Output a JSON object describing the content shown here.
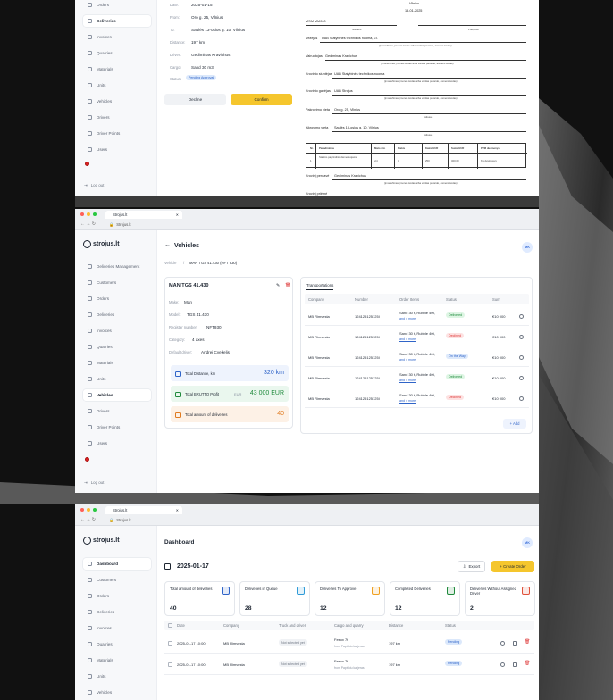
{
  "colors": {
    "accent": "#f5c62d",
    "primary": "#2f64c8",
    "success": "#1f8a3c",
    "danger": "#d33"
  },
  "w1": {
    "nav": [
      {
        "label": "Orders",
        "active": false
      },
      {
        "label": "Deliveries",
        "active": true
      },
      {
        "label": "Invoices",
        "active": false
      },
      {
        "label": "Quarries",
        "active": false
      },
      {
        "label": "Materials",
        "active": false
      },
      {
        "label": "Units",
        "active": false
      },
      {
        "label": "Vehicles",
        "active": false
      },
      {
        "label": "Drivers",
        "active": false
      },
      {
        "label": "Driver Points",
        "active": false
      },
      {
        "label": "Users",
        "active": false
      }
    ],
    "logout": "Log out",
    "details": {
      "date_label": "Date:",
      "date": "2025-01-15",
      "from_label": "From:",
      "from": "Oro g. 25, Vilnius",
      "to_label": "To:",
      "to": "Saulės 13-osios g. 10, Vilnius",
      "distance_label": "Distance:",
      "distance": "197 km",
      "driver_label": "Driver:",
      "driver": "Gediminas Kravichus",
      "cargo_label": "Cargo:",
      "cargo": "Sand 30 m3",
      "status_label": "Status:",
      "status": "Pending Approval"
    },
    "decline": "Decline",
    "confirm": "Confirm",
    "doc": {
      "city": "Vilnius",
      "date": "15-01-2025",
      "number": "MSM MM000",
      "sub1": "Numeris",
      "sub2": "Prekybos",
      "vezejas_label": "Vežėjas",
      "vezejas": "UAB Statybinės technikos nuoma, Lt.",
      "vezejas_sub": "(įmonė/limas, įmonės kodas arba vardas pavardė, asmens kodas)",
      "vezejas_sub2": "(įmonė/limas, įmonės kodas arba vardas pavardė, asmens kodas)",
      "vairuotojas_label": "Vairuotojas",
      "vairuotojas": "Gediminas Kravichus",
      "vairuotojas_sub": "(įmonė/limas, įmonės kodas arba vardas pavardė, asmens kodas)",
      "siuntejas_label": "Krovinio siuntėjas",
      "siuntejas": "UAB Statybinės technikos nuoma",
      "siuntejas_sub": "(įmonė/limas, įmonės kodas arba vardas pavardė, asmens kodas)",
      "gavejas_label": "Krovinio gavėjas",
      "gavejas": "UAB Strojus",
      "gavejas_sub": "(įmonė/limas, įmonės kodas arba vardas pavardė, asmens kodas)",
      "pakrovimo_label": "Pakrovimo vieta",
      "pakrovimo": "Oro g. 25, Vilnius",
      "pakrovimo_sub": "Adresas",
      "iskrovimo_label": "Iškrovimo vieta",
      "iskrovimo": "Saulės 13-osios g. 10, Vilnius",
      "iskrovimo_sub": "Adresas",
      "table_headers": [
        "Nr.",
        "Pavadinimas",
        "Mato vnt.",
        "Kiekis",
        "Kaina EUR",
        "Suma EUR",
        "PVM duomenys"
      ],
      "table_row": [
        "1",
        "Statinio pagrindinis dėmesiuojama",
        "vnt",
        "3",
        "250",
        "320.00",
        "KS devimosys"
      ],
      "priemes_label": "Krovinį perdavė",
      "priemes": "Gediminas Kravichus",
      "priemes_sub": "(įmonė/limas, įmonės kodas arba vardas pavardė, asmens kodas)",
      "footer_label": "Krovinį priėmė"
    }
  },
  "w2": {
    "tab_title": "Strojus.lt",
    "url": "Strojus.lt",
    "logo": "strojus.lt",
    "nav": [
      {
        "label": "Deliveries Management",
        "active": false
      },
      {
        "label": "Customers",
        "active": false
      },
      {
        "label": "Orders",
        "active": false
      },
      {
        "label": "Deliveries",
        "active": false
      },
      {
        "label": "Invoices",
        "active": false
      },
      {
        "label": "Quarries",
        "active": false
      },
      {
        "label": "Materials",
        "active": false
      },
      {
        "label": "Units",
        "active": false
      },
      {
        "label": "Vehicles",
        "active": true
      },
      {
        "label": "Drivers",
        "active": false
      },
      {
        "label": "Driver Points",
        "active": false
      },
      {
        "label": "Users",
        "active": false
      }
    ],
    "logout": "Log out",
    "page_title": "Vehicles",
    "avatar": "MK",
    "breadcrumb_root": "Vehicle",
    "breadcrumb_sep": "/",
    "breadcrumb_current": "MAN TGS 41.430 (NFT 930)",
    "vehicle": {
      "name": "MAN TGS 41.430",
      "make_label": "Make:",
      "make": "Man",
      "model_label": "Model:",
      "model": "TGS 41.430",
      "reg_label": "Register number:",
      "reg": "NFT930",
      "cat_label": "Category:",
      "cat": "4 axes",
      "driver_label": "Default driver:",
      "driver": "Andrej Cvekelis"
    },
    "metrics": [
      {
        "label": "Total Distance, km",
        "unit": "",
        "value": "320 km",
        "color": "#2f64c8",
        "bg": "#eef3fd"
      },
      {
        "label": "Total BRUTTO Profit",
        "unit": "EUR",
        "value": "43 000 EUR",
        "color": "#1f8a3c",
        "bg": "#eaf7ee"
      },
      {
        "label": "Total amount of deliveries",
        "unit": "",
        "value": "40",
        "color": "#e07a1f",
        "bg": "#fdf1e6"
      }
    ],
    "tab_transport": "Transportations",
    "headers": [
      "Company",
      "Number",
      "Order Items",
      "Status",
      "Sum"
    ],
    "rows": [
      {
        "company": "MB Rimvesta",
        "number": "124125125125l",
        "items": "Sand 30 t, Rubble 40t,",
        "more": "and 4 more",
        "status": "Delivered",
        "cls": "b-del",
        "sum": "€10 000"
      },
      {
        "company": "MB Rimvesta",
        "number": "124125125125l",
        "items": "Sand 30 t, Rubble 40t,",
        "more": "and 4 more",
        "status": "Declined",
        "cls": "b-dec",
        "sum": "€10 000"
      },
      {
        "company": "MB Rimvesta",
        "number": "124125125125l",
        "items": "Sand 30 t, Rubble 40t,",
        "more": "and 4 more",
        "status": "On the Way",
        "cls": "b-way",
        "sum": "€10 000"
      },
      {
        "company": "MB Rimvesta",
        "number": "124125125125l",
        "items": "Sand 30 t, Rubble 40t,",
        "more": "and 4 more",
        "status": "Delivered",
        "cls": "b-del",
        "sum": "€10 000"
      },
      {
        "company": "MB Rimvesta",
        "number": "124125125125l",
        "items": "Sand 30 t, Rubble 40t,",
        "more": "and 4 more",
        "status": "Declined",
        "cls": "b-dec",
        "sum": "€10 000"
      }
    ],
    "add_button": "+ Add"
  },
  "w3": {
    "tab_title": "Strojus.lt",
    "url": "Strojus.lt",
    "logo": "strojus.lt",
    "nav": [
      {
        "label": "Dashboard",
        "active": true
      },
      {
        "label": "Customers",
        "active": false
      },
      {
        "label": "Orders",
        "active": false
      },
      {
        "label": "Deliveries",
        "active": false
      },
      {
        "label": "Invoices",
        "active": false
      },
      {
        "label": "Quarries",
        "active": false
      },
      {
        "label": "Materials",
        "active": false
      },
      {
        "label": "Units",
        "active": false
      },
      {
        "label": "Vehicles",
        "active": false
      }
    ],
    "page_title": "Dashboard",
    "avatar": "MK",
    "date": "2025-01-17",
    "export": "Export",
    "create": "+ Create Order",
    "stats": [
      {
        "label": "Total amount of deliveries",
        "value": "40",
        "color": "#2f64c8"
      },
      {
        "label": "Deliveries in Queue",
        "value": "28",
        "color": "#2f9bd8"
      },
      {
        "label": "Deliveries To Approve",
        "value": "12",
        "color": "#f0a020"
      },
      {
        "label": "Completed Deliveries",
        "value": "12",
        "color": "#1f8a3c"
      },
      {
        "label": "Deliveries Without Assigned Driver",
        "value": "2",
        "color": "#e0513a"
      }
    ],
    "headers": [
      "Date",
      "Company",
      "Truck and driver",
      "Cargo and quarry",
      "Distance",
      "Status"
    ],
    "rows": [
      {
        "date": "2025-01-17 10:00",
        "company": "MB Rimvesta",
        "truck": "Not selected yet",
        "cargo": "Fesox 7t",
        "quarry": "from Papiskiu karjeras",
        "distance": "197 km",
        "status": "Pending"
      },
      {
        "date": "2025-01-17 10:00",
        "company": "MB Rimvesta",
        "truck": "Not selected yet",
        "cargo": "Fesox 7t",
        "quarry": "from Papiskiu karjeras",
        "distance": "197 km",
        "status": "Pending"
      }
    ]
  }
}
